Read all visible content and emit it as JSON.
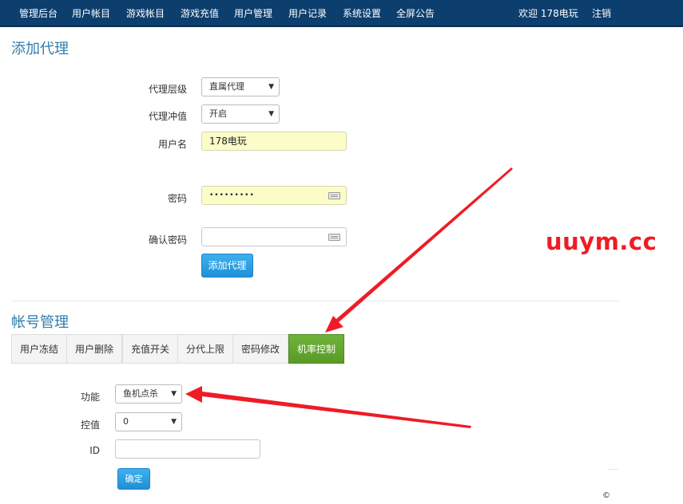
{
  "nav": {
    "items": [
      "管理后台",
      "用户帐目",
      "游戏帐目",
      "游戏充值",
      "用户管理",
      "用户记录",
      "系统设置",
      "全屏公告"
    ],
    "welcome": "欢迎 178电玩",
    "logout": "注销"
  },
  "add_agent": {
    "title": "添加代理",
    "level_label": "代理层级",
    "level_value": "直属代理",
    "recharge_label": "代理冲值",
    "recharge_value": "开启",
    "username_label": "用户名",
    "username_value": "178电玩",
    "password_label": "密码",
    "password_value": "•••••••••",
    "confirm_label": "确认密码",
    "confirm_value": "",
    "submit_label": "添加代理"
  },
  "account": {
    "title": "帐号管理",
    "tabs": [
      "用户冻结",
      "用户删除",
      "充值开关",
      "分代上限",
      "密码修改",
      "机率控制"
    ],
    "active_tab": "机率控制",
    "function_label": "功能",
    "function_value": "鱼机点杀",
    "control_label": "控值",
    "control_value": "0",
    "id_label": "ID",
    "id_value": "",
    "confirm_label": "确定"
  },
  "watermark": "uuym.cc",
  "copyright": "©",
  "colors": {
    "nav_bg": "#0c3e6e",
    "title": "#317eac",
    "primary_button": "#1f90d6",
    "active_tab": "#5a9a28",
    "annotation": "#ee1c25"
  }
}
